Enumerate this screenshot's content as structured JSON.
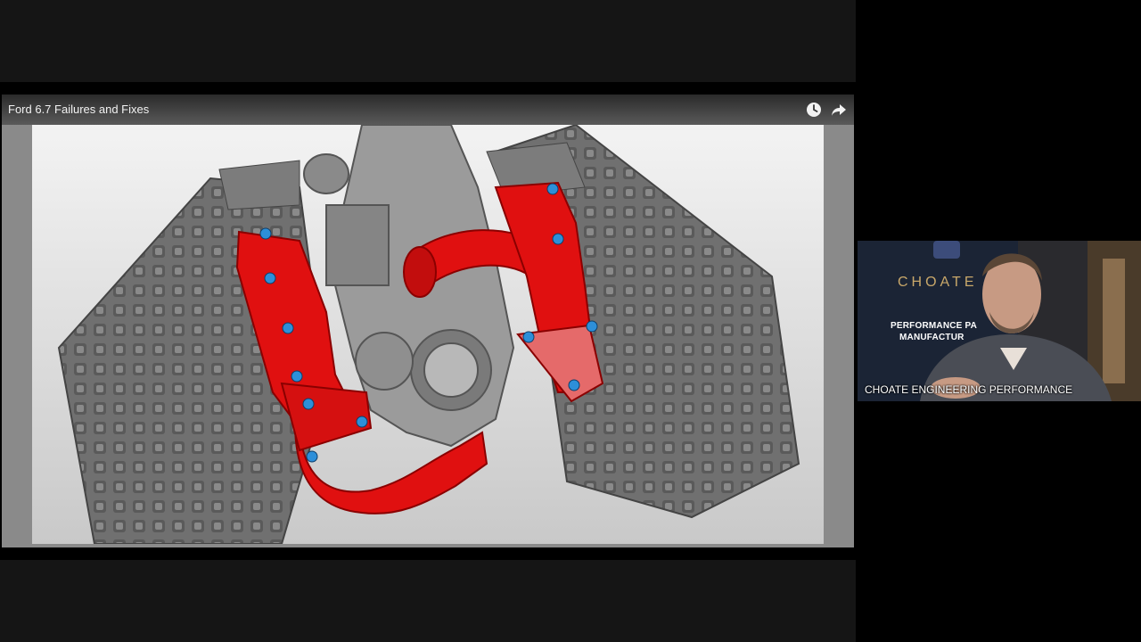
{
  "video": {
    "title": "Ford 6.7 Failures and Fixes",
    "icons": {
      "clock": "clock-icon",
      "share": "share-icon"
    }
  },
  "webcam": {
    "caption": "CHOATE ENGINEERING PERFORMANCE",
    "banner_brand": "CHOATE",
    "banner_line1": "PERFORMANCE PA",
    "banner_line2": "MANUFACTUR"
  },
  "colors": {
    "manifold_red": "#e01010",
    "engine_gray": "#6e6e6e",
    "bolt_blue": "#2d8fd9",
    "brand_gold": "#c9a86a"
  }
}
